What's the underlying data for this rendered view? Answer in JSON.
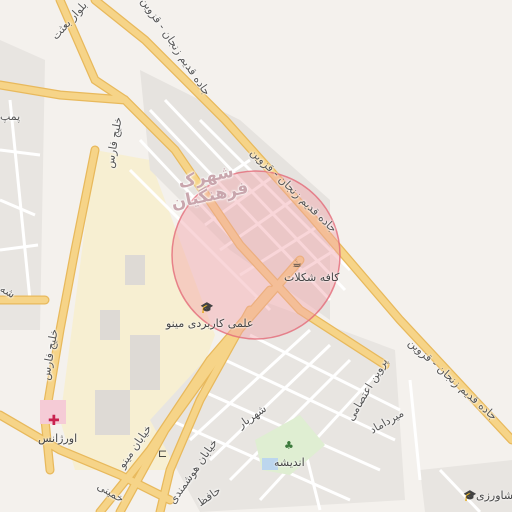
{
  "colors": {
    "background": "#f4f1ed",
    "campus": "#f7efd2",
    "built_area": "#e6e3df",
    "major_road": "#f6d488",
    "major_road_edge": "#e8b95c",
    "minor_road": "#ffffff",
    "park": "#dfeed2",
    "search_circle_fill": "#f2a3aa",
    "search_circle_stroke": "#e46a78",
    "hospital": "#e6446b"
  },
  "map": {
    "area_label": "شهرک\nفرهنگیان",
    "roads": {
      "blvd_besat": "بلوار بعثت",
      "qazvin_top": "جاده قدیم زنجان - قزوین",
      "qazvin_mid": "جاده قدیم زنجان - قزوین",
      "qazvin_low": "جاده قدیم زنجان - قزوین",
      "khalij_fars_1": "خلیج فارس",
      "khalij_fars_2": "خلیج فارس",
      "parvin": "پروین اعتصامی",
      "mirdamad": "میرداماد",
      "shahriyar": "شهریار",
      "khayyam": "خیابان مینو",
      "hafez": "حافظ",
      "khomeini": "خمینی",
      "hoshmandi": "خیابان هوشمندی",
      "pump": "پمپ",
      "left_short": "شه"
    },
    "pois": {
      "cafe": "کافه شکلات",
      "university": "علمی کاربردی مینو",
      "hospital": "اورژانس",
      "park": "اندیشه",
      "keshavarzi": "جه کشاورزی"
    },
    "icons": {
      "cafe": "cafe-icon",
      "university": "graduation-cap-icon",
      "hospital": "hospital-cross-icon",
      "park": "tree-icon",
      "hotel": "bed-icon"
    }
  }
}
